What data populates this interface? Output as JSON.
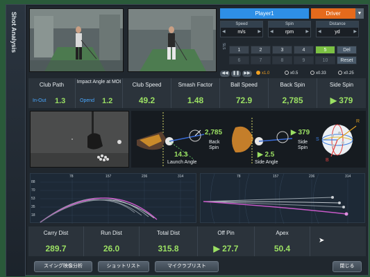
{
  "sidebar": {
    "title": "Shot Analysis"
  },
  "controls": {
    "player_label": "Player1",
    "club_label": "Driver",
    "units": [
      {
        "label": "Speed",
        "value": "m/s"
      },
      {
        "label": "Spin",
        "value": "rpm"
      },
      {
        "label": "Distance",
        "value": "yd"
      }
    ],
    "sls_label": "SLS",
    "shots_row1": [
      "1",
      "2",
      "3",
      "4",
      "5",
      "Del"
    ],
    "shots_row2": [
      "6",
      "7",
      "8",
      "9",
      "10",
      "Reset"
    ],
    "selected_shot": "5",
    "playback": {
      "speeds": [
        "x1.0",
        "x0.5",
        "x0.33",
        "x0.25"
      ],
      "selected": "x1.0"
    }
  },
  "metrics_top": [
    {
      "title": "Club Path",
      "sub": "In-Out",
      "value": "1.3"
    },
    {
      "title": "Impact Angle at MOI",
      "sub": "Opend",
      "value": "1.2"
    },
    {
      "title": "Club Speed",
      "value": "49.2"
    },
    {
      "title": "Smash Factor",
      "value": "1.48"
    },
    {
      "title": "Ball Speed",
      "value": "72.9"
    },
    {
      "title": "Back Spin",
      "value": "2,785"
    },
    {
      "title": "Side Spin",
      "value": "379",
      "arrow": "▶"
    }
  ],
  "launch": {
    "back_spin_value": "2,785",
    "back_spin_label": "Back Spin",
    "launch_angle_value": "14.3",
    "launch_angle_label": "Launch Angle",
    "side_spin_value": "▶ 379",
    "side_spin_label": "Side Spin",
    "side_angle_value": "▶ 2.5",
    "side_angle_label": "Side Angle",
    "axis_r": "R",
    "axis_s": "S",
    "axis_b": "B"
  },
  "graph1": {
    "xticks": [
      "78",
      "157",
      "236",
      "314"
    ],
    "yticks": [
      "88",
      "70",
      "53",
      "35",
      "18"
    ]
  },
  "graph2": {
    "xticks": [
      "78",
      "157",
      "236",
      "314"
    ]
  },
  "metrics_bottom": [
    {
      "title": "Carry Dist",
      "value": "289.7"
    },
    {
      "title": "Run Dist",
      "value": "26.0"
    },
    {
      "title": "Total Dist",
      "value": "315.8"
    },
    {
      "title": "Off Pin",
      "value": "27.7",
      "arrow": "▶"
    },
    {
      "title": "Apex",
      "value": "50.4"
    }
  ],
  "buttons": {
    "swing_video": "スイング映像分析",
    "shot_list": "ショットリスト",
    "my_club_list": "マイクラブリスト",
    "close": "閉じる"
  }
}
